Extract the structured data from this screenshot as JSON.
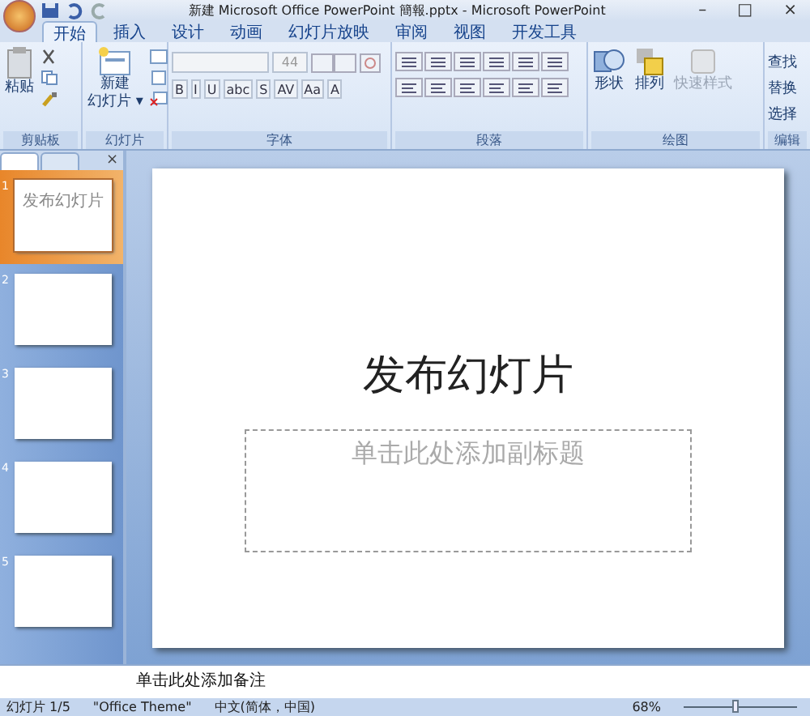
{
  "window": {
    "title": "新建 Microsoft Office PowerPoint 簡報.pptx - Microsoft PowerPoint",
    "controls": [
      "–",
      "□",
      "×"
    ]
  },
  "tabs": [
    {
      "label": "开始",
      "selected": true
    },
    {
      "label": "插入",
      "selected": false
    },
    {
      "label": "设计",
      "selected": false
    },
    {
      "label": "动画",
      "selected": false
    },
    {
      "label": "幻灯片放映",
      "selected": false
    },
    {
      "label": "审阅",
      "selected": false
    },
    {
      "label": "视图",
      "selected": false
    },
    {
      "label": "开发工具",
      "selected": false
    }
  ],
  "ribbon": {
    "clipboard": {
      "paste": "粘贴",
      "label": "剪贴板"
    },
    "slides": {
      "new_line1": "新建",
      "new_line2": "幻灯片 ▾",
      "label": "幻灯片"
    },
    "font": {
      "size": "44",
      "buttons": [
        "B",
        "I",
        "U",
        "abc",
        "S",
        "AV",
        "Aa",
        "A"
      ],
      "label": "字体"
    },
    "paragraph": {
      "label": "段落"
    },
    "drawing": {
      "buttons": [
        {
          "label": "形状",
          "kind": "shapes",
          "disabled": false
        },
        {
          "label": "排列",
          "kind": "arrange",
          "disabled": false
        },
        {
          "label": "快速样式",
          "kind": "styles",
          "disabled": true
        }
      ],
      "label": "绘图"
    },
    "editing": {
      "items": [
        "查找",
        "替换",
        "选择"
      ],
      "label": "编辑"
    }
  },
  "panel": {
    "close": "×",
    "thumbnails": [
      {
        "number": "1",
        "selected": true,
        "title": "发布幻灯片"
      },
      {
        "number": "2",
        "selected": false
      },
      {
        "number": "3",
        "selected": false
      },
      {
        "number": "4",
        "selected": false
      },
      {
        "number": "5",
        "selected": false
      }
    ]
  },
  "slide": {
    "title": "发布幻灯片",
    "subtitle_placeholder": "单击此处添加副标题"
  },
  "notes": {
    "placeholder": "单击此处添加备注"
  },
  "status_bar": {
    "slide": "幻灯片 1/5",
    "theme": "\"Office Theme\"",
    "language": "中文(简体，中国)",
    "zoom": "68%",
    "zoom_slider": {
      "level": 0.45
    }
  }
}
